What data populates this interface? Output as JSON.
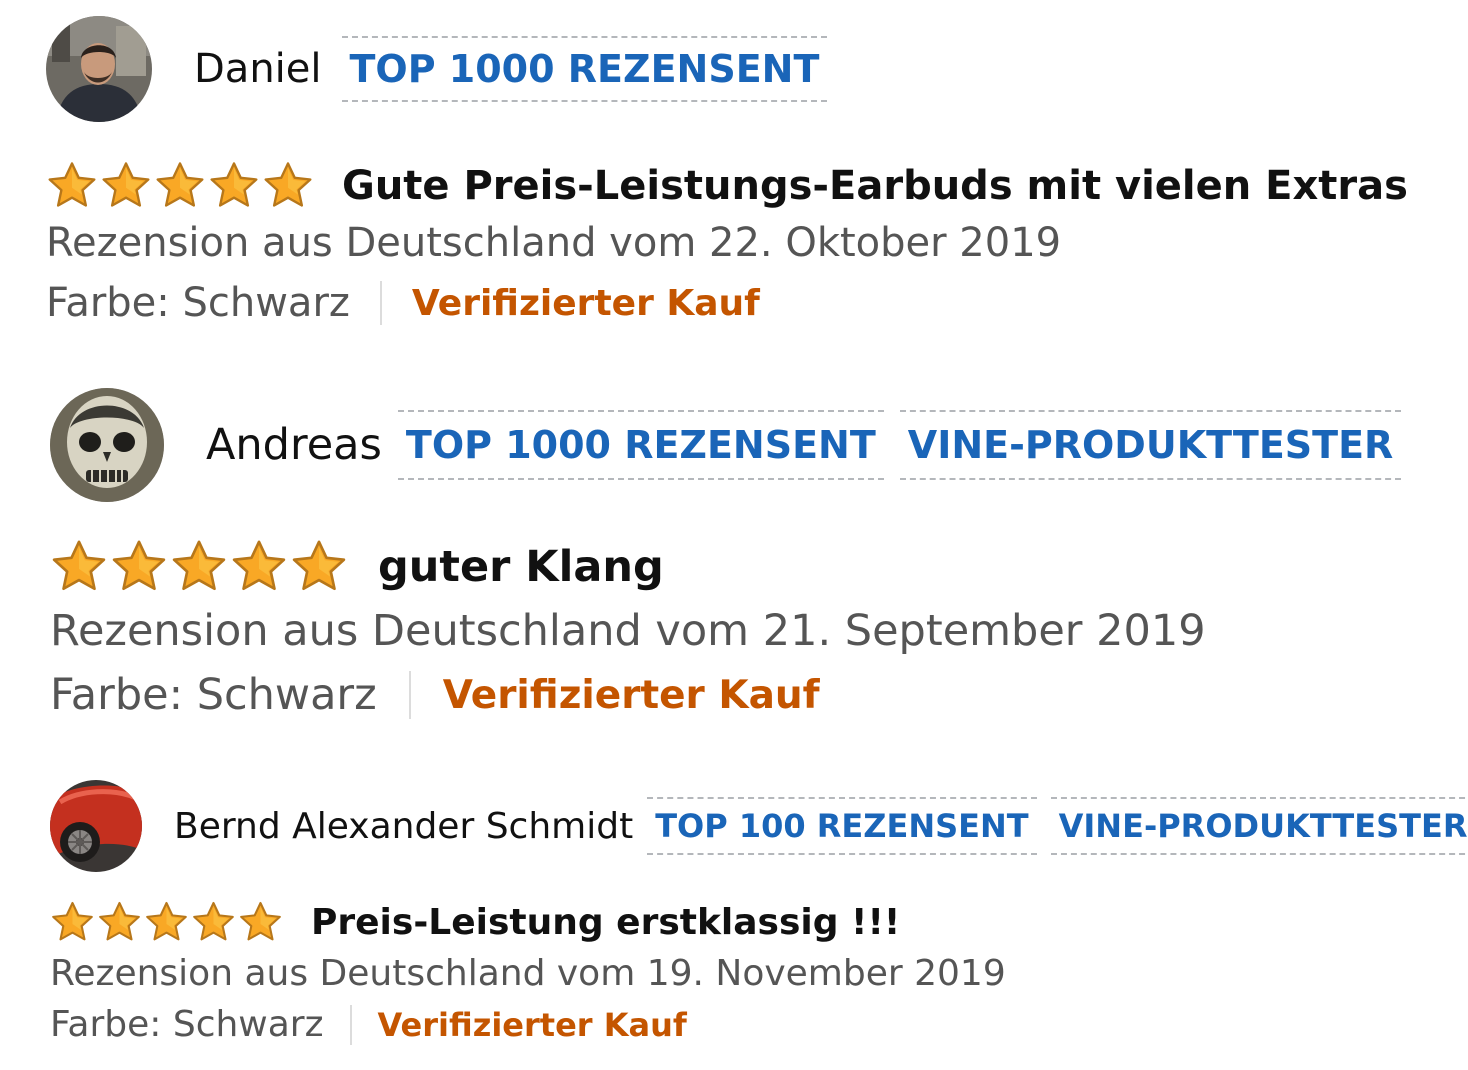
{
  "colors": {
    "badge_text": "#1a65b8",
    "badge_border": "#b4b7bb",
    "verified": "#c45500",
    "star_fill": "#f9a825",
    "muted_text": "#555555"
  },
  "reviews": [
    {
      "reviewer": "Daniel",
      "avatar_icon": "user-photo-avatar",
      "badges": [
        "TOP 1000 REZENSENT"
      ],
      "rating": 5,
      "max_rating": 5,
      "title": "Gute Preis-Leistungs-Earbuds mit vielen Extras",
      "date": "Rezension aus Deutschland vom 22. Oktober 2019",
      "color": "Farbe: Schwarz",
      "verified": "Verifizierter Kauf"
    },
    {
      "reviewer": "Andreas",
      "avatar_icon": "skull-face-avatar",
      "badges": [
        "TOP 1000 REZENSENT",
        "VINE-PRODUKTTESTER"
      ],
      "rating": 5,
      "max_rating": 5,
      "title": "guter Klang",
      "date": "Rezension aus Deutschland vom 21. September 2019",
      "color": "Farbe: Schwarz",
      "verified": "Verifizierter Kauf"
    },
    {
      "reviewer": "Bernd Alexander Schmidt",
      "avatar_icon": "red-car-avatar",
      "badges": [
        "TOP 100 REZENSENT",
        "VINE-PRODUKTTESTER"
      ],
      "rating": 5,
      "max_rating": 5,
      "title": "Preis-Leistung erstklassig !!!",
      "date": "Rezension aus Deutschland vom 19. November 2019",
      "color": "Farbe: Schwarz",
      "verified": "Verifizierter Kauf"
    }
  ]
}
